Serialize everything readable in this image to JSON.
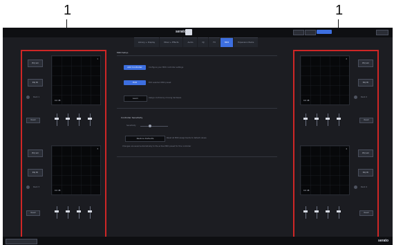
{
  "callouts": {
    "left": "1",
    "right": "1"
  },
  "app": {
    "logo": "serato",
    "logo_badge": "DJ",
    "tabs": [
      {
        "label": "Library + Display",
        "active": false
      },
      {
        "label": "Mixer + Effects",
        "active": false
      },
      {
        "label": "Audio",
        "active": false
      },
      {
        "label": "DJ",
        "active": false
      },
      {
        "label": "FX",
        "active": false
      },
      {
        "label": "MIDI",
        "active": true
      },
      {
        "label": "Expansion Packs",
        "active": false
      }
    ],
    "topbar_blue_label": "Setup"
  },
  "panels": {
    "left": {
      "decks": [
        {
          "label": "Deck 1",
          "readout": "0.0 dB",
          "value": "1"
        },
        {
          "label": "Deck 3",
          "readout": "0.0 dB",
          "value": "3"
        }
      ]
    },
    "right": {
      "decks": [
        {
          "label": "Deck 2",
          "readout": "0.0 dB",
          "value": "2"
        },
        {
          "label": "Deck 4",
          "readout": "0.0 dB",
          "value": "4"
        }
      ]
    },
    "eq_buttons": [
      "EQ LO",
      "EQ HI"
    ],
    "small_button": "Reset"
  },
  "center": {
    "section1": "MIDI Setup",
    "buttons": [
      {
        "label": "Add Controller",
        "desc": "Configure your MIDI controller settings",
        "style": "blue"
      },
      {
        "label": "Edit",
        "desc": "Edit selected MIDI preset",
        "style": "blue"
      },
      {
        "label": "Learn",
        "desc": "Assign controls by moving hardware",
        "style": "dark"
      }
    ],
    "section2": "Controller Sensitivity",
    "slider_label": "Sensitivity",
    "slider_value": 0.35,
    "button2": "Restore Defaults",
    "button2_desc": "Reset all MIDI assignments to default values",
    "note": "Changes are saved automatically to the active MIDI preset for this controller"
  }
}
